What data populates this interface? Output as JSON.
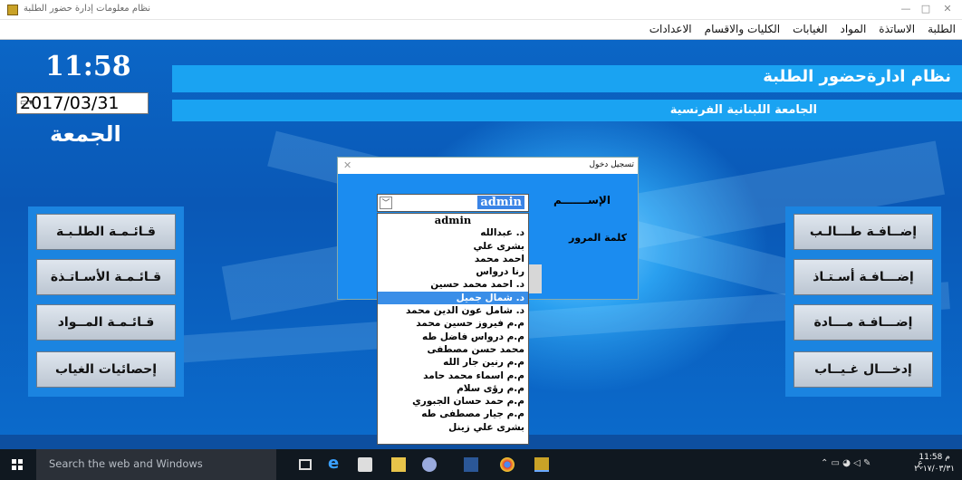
{
  "window": {
    "title": "نظام معلومات إدارة حضور الطلبة",
    "minimize": "—",
    "maximize": "□",
    "close": "✕"
  },
  "menu": [
    "الطلبة",
    "الاساتذة",
    "المواد",
    "الغيابات",
    "الكليات والاقسام",
    "الاعدادات"
  ],
  "header": {
    "title": "نظام ادارةحضور الطلبة",
    "subtitle": "الجامعة اللبنانية الفرنسية"
  },
  "clock": {
    "time": "11:58",
    "date": "2017/03/31",
    "day": "الجمعة"
  },
  "left_buttons": [
    "قـائـمـة الطلـبـة",
    "قـائـمـة الأسـاتـذة",
    "قـائـمـة المــواد",
    "إحصائيات الغياب"
  ],
  "right_buttons": [
    "إضــافـة طـــالـب",
    "إضـــافـة أسـتـاذ",
    "إضـــافـة مـــادة",
    "إدخـــال غـيــاب"
  ],
  "login": {
    "title": "تسجيل دخول",
    "close": "✕",
    "name_label": "الإســـــــم",
    "password_label": "كلمة المرور",
    "selected": "admin",
    "options": [
      "admin",
      "د. عبدالله",
      "بشرى علي",
      "احمد محمد",
      "رنا درواس",
      "د. احمد محمد حسين",
      "د. شمال جميل",
      "د. شامل عون الدين محمد",
      "م.م فيروز حسين محمد",
      "م.م درواس فاضل طه",
      "محمد حسن مصطفى",
      "م.م رنين جار الله",
      "م.م اسماء محمد حامد",
      "م.م رؤى سلام",
      "م.م حمد حسان الجبوري",
      "م.م جيار مصطفى طه",
      "بشرى علي زينل"
    ],
    "highlighted_index": 6
  },
  "taskbar": {
    "search_placeholder": "Search the web and Windows",
    "time": "11:58 م",
    "date": "٢٠١٧/٠٣/٣١",
    "lang": "ع"
  },
  "colors": {
    "accent": "#1aa3f2",
    "panel": "#1b84e0",
    "desktop": "#0b66c6"
  }
}
